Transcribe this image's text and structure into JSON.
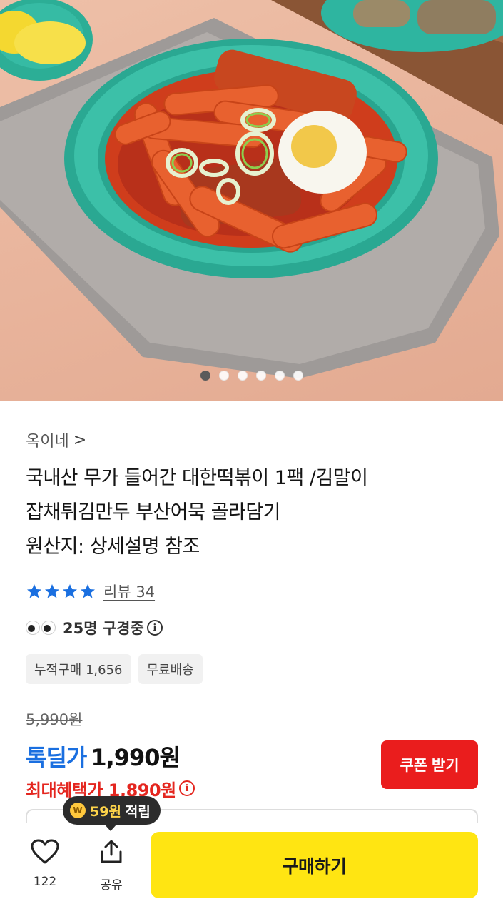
{
  "hero": {
    "image_alt": "떡볶이 상품 이미지",
    "page_count": 6,
    "active_index": 0
  },
  "product": {
    "seller": "옥이네",
    "seller_chevron": ">",
    "title_lines": [
      "국내산 무가 들어간 대한떡볶이 1팩 /김말이",
      "잡채튀김만두 부산어묵 골라담기",
      "원산지: 상세설명 참조"
    ],
    "rating_stars": 4,
    "review_label": "리뷰 34",
    "viewers_label": "25명 구경중",
    "badges": [
      "누적구매 1,656",
      "무료배송"
    ],
    "original_price": "5,990원",
    "deal_label": "톡딜가",
    "deal_price": "1,990원",
    "max_benefit_label": "최대혜택가 1,890원",
    "coupon_button": "쿠폰 받기"
  },
  "bottom_bar": {
    "like_count": "122",
    "share_label": "공유",
    "reward_amount": "59원",
    "reward_suffix": "적립",
    "buy_button": "구매하기"
  },
  "colors": {
    "deal_blue": "#1a6fe0",
    "benefit_red": "#e4261f",
    "coupon_red": "#ea1d1d",
    "buy_yellow": "#ffe512",
    "star_blue": "#1a6fe0"
  },
  "icons": [
    "chevron-right-icon",
    "star-icon",
    "eyes-icon",
    "info-icon",
    "heart-icon",
    "share-icon",
    "coin-icon"
  ]
}
